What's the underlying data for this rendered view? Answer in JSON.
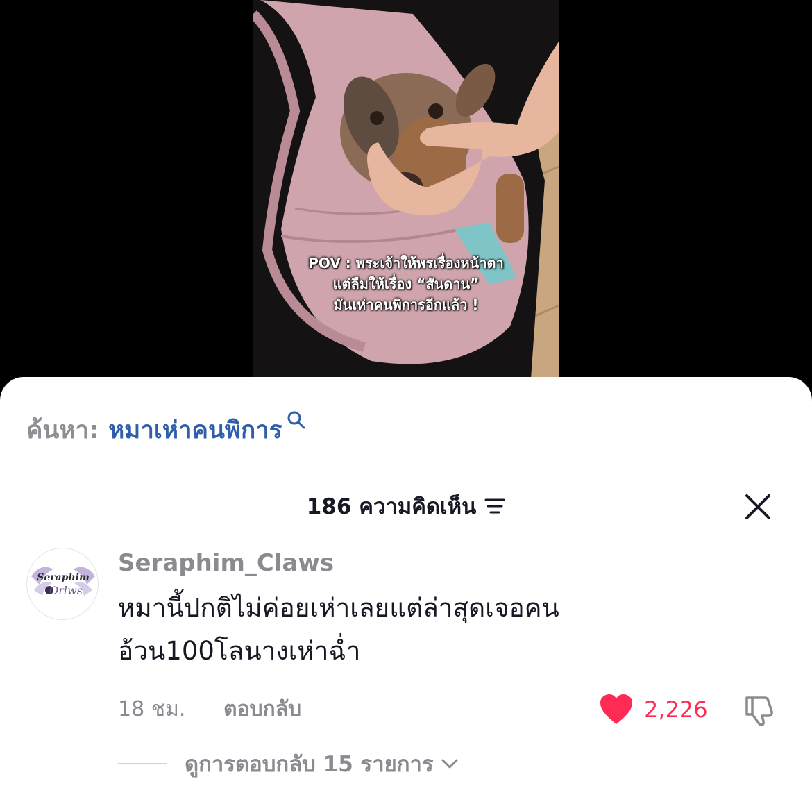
{
  "video": {
    "caption_lines": [
      "POV : พระเจ้าให้พรเรื่องหน้าตา",
      "แต่ลืมให้เรื่อง “สันดาน”",
      "มันเห่าคนพิการอีกแล้ว !"
    ]
  },
  "search": {
    "prefix": "ค้นหา:",
    "term": "หมาเห่าคนพิการ",
    "icon": "search-icon"
  },
  "comments_header": {
    "title": "186 ความคิดเห็น",
    "sort_icon": "sort-lines-icon",
    "close_icon": "close-icon"
  },
  "comment": {
    "avatar_text_top": "Seraphim",
    "avatar_text_bottom": "Orlws",
    "username": "Seraphim_Claws",
    "text_lines": [
      "หมานี้ปกติไม่ค่อยเห่าเลยแต่ล่าสุดเจอคน",
      "อ้วน100โลนางเห่าฉ่ำ"
    ],
    "timestamp": "18 ชม.",
    "reply_label": "ตอบกลับ",
    "like_count": "2,226",
    "like_icon": "heart-icon",
    "dislike_icon": "thumbs-down-icon",
    "view_replies_label": "ดูการตอบกลับ 15 รายการ"
  },
  "colors": {
    "like": "#fe2c55",
    "search_term": "#2f5fa9",
    "secondary_text": "#8a8b91",
    "primary_text": "#161823"
  }
}
